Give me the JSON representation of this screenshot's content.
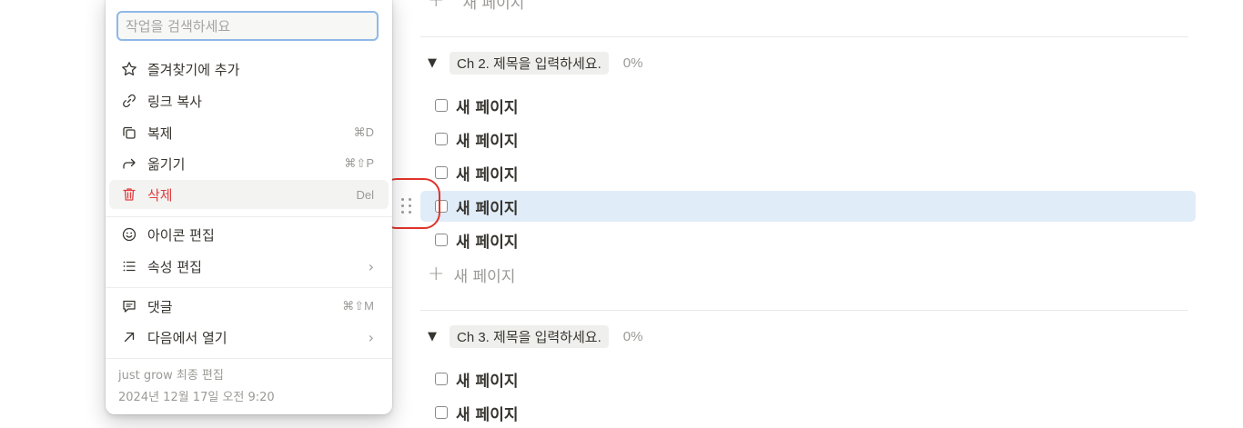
{
  "board": {
    "top_add_label": "새 페이지",
    "groups": [
      {
        "title": "Ch 2. 제목을 입력하세요.",
        "percent": "0%",
        "items": [
          "새 페이지",
          "새 페이지",
          "새 페이지",
          "새 페이지",
          "새 페이지"
        ],
        "add_label": "새 페이지"
      },
      {
        "title": "Ch 3. 제목을 입력하세요.",
        "percent": "0%",
        "items": [
          "새 페이지",
          "새 페이지"
        ]
      }
    ]
  },
  "menu": {
    "search_placeholder": "작업을 검색하세요",
    "items": [
      {
        "label": "즐겨찾기에 추가",
        "shortcut": "",
        "icon": "star-icon"
      },
      {
        "label": "링크 복사",
        "shortcut": "",
        "icon": "link-icon"
      },
      {
        "label": "복제",
        "shortcut": "⌘D",
        "icon": "duplicate-icon"
      },
      {
        "label": "옮기기",
        "shortcut": "⌘⇧P",
        "icon": "move-arrow-icon"
      },
      {
        "label": "삭제",
        "shortcut": "Del",
        "icon": "trash-icon"
      },
      {
        "label": "아이콘 편집",
        "shortcut": "",
        "icon": "smiley-icon"
      },
      {
        "label": "속성 편집",
        "shortcut": "",
        "icon": "list-icon"
      },
      {
        "label": "댓글",
        "shortcut": "⌘⇧M",
        "icon": "comment-icon"
      },
      {
        "label": "다음에서 열기",
        "shortcut": "",
        "icon": "open-arrow-icon"
      }
    ],
    "footer": {
      "editor_line": "just grow 최종 편집",
      "date_line": "2024년 12월 17일 오전 9:20"
    }
  },
  "colors": {
    "danger": "#e03e3e",
    "highlight_row": "#e1ecf9",
    "annotation_circle": "#e0332a"
  }
}
